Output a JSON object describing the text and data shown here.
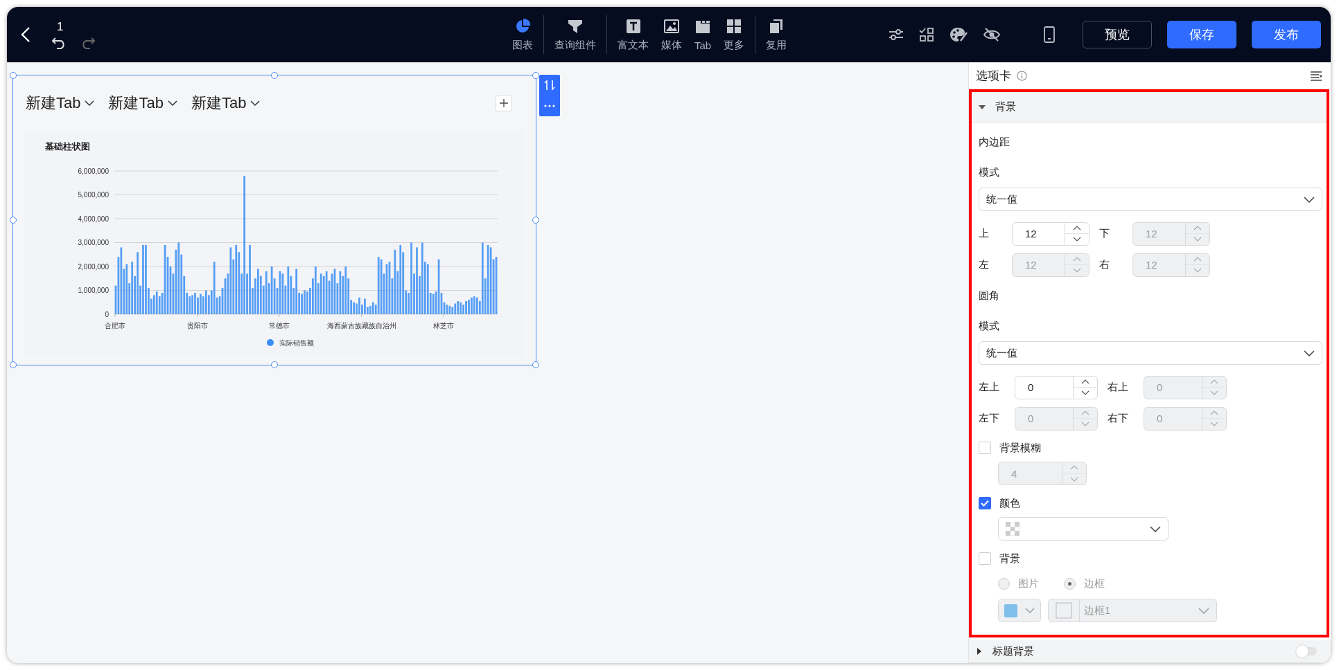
{
  "toolbar": {
    "page_number": "1",
    "undo_disabled": false,
    "redo_disabled": true,
    "tool_groups": [
      [
        {
          "label": "图表",
          "selected": true
        }
      ],
      [
        {
          "label": "查询组件",
          "selected": false
        }
      ],
      [
        {
          "label": "富文本",
          "selected": false
        },
        {
          "label": "媒体",
          "selected": false
        },
        {
          "label": "Tab",
          "selected": false
        },
        {
          "label": "更多",
          "selected": false
        }
      ],
      [
        {
          "label": "复用",
          "selected": false
        }
      ]
    ],
    "buttons": [
      {
        "label": "预览",
        "kind": "outline"
      },
      {
        "label": "保存",
        "kind": "primary"
      },
      {
        "label": "发布",
        "kind": "primary"
      }
    ]
  },
  "canvas": {
    "tabs": [
      {
        "label": "新建Tab"
      },
      {
        "label": "新建Tab"
      },
      {
        "label": "新建Tab"
      }
    ],
    "chart": {
      "x_labels": [
        "合肥市",
        "贵阳市",
        "常德市",
        "海西蒙古族藏族自治州",
        "林芝市"
      ],
      "chart_data": {
        "type": "bar",
        "title": "基础柱状图",
        "grid": true,
        "series": [
          {
            "name": "实际销售额",
            "color": "#3a8ef6",
            "values": [
              1200000,
              2400000,
              2800000,
              1900000,
              2100000,
              1300000,
              2200000,
              1600000,
              2600000,
              1200000,
              2900000,
              2900000,
              1100000,
              650000,
              800000,
              950000,
              750000,
              900000,
              2900000,
              2400000,
              2000000,
              1700000,
              2700000,
              3000000,
              2500000,
              1600000,
              900000,
              750000,
              800000,
              900000,
              700000,
              850000,
              750000,
              1000000,
              800000,
              1000000,
              2200000,
              700000,
              750000,
              1100000,
              1500000,
              1700000,
              2800000,
              2300000,
              2900000,
              2600000,
              1700000,
              5800000,
              1700000,
              2900000,
              1100000,
              1500000,
              1900000,
              1600000,
              1200000,
              1800000,
              1300000,
              2000000,
              1500000,
              1100000,
              1800000,
              1700000,
              1200000,
              2000000,
              1600000,
              1100000,
              1900000,
              900000,
              850000,
              1000000,
              950000,
              1100000,
              1500000,
              2000000,
              1300000,
              1700000,
              1600000,
              1800000,
              1400000,
              1700000,
              1900000,
              1300000,
              1800000,
              1600000,
              2000000,
              1500000,
              600000,
              500000,
              450000,
              700000,
              400000,
              650000,
              300000,
              350000,
              500000,
              400000,
              2400000,
              2300000,
              1700000,
              2100000,
              2200000,
              1500000,
              2700000,
              1800000,
              2900000,
              2600000,
              1000000,
              900000,
              3000000,
              1700000,
              2800000,
              1600000,
              3000000,
              2200000,
              2100000,
              900000,
              850000,
              950000,
              2300000,
              900000,
              500000,
              400000,
              350000,
              300000,
              450000,
              550000,
              500000,
              400000,
              550000,
              600000,
              700000,
              750000,
              700000,
              550000,
              3000000,
              1500000,
              2900000,
              2800000,
              2300000,
              2400000
            ]
          }
        ],
        "ylim": [
          0,
          6000000
        ],
        "yticks": [
          {
            "value": 0,
            "label": "0"
          },
          {
            "value": 1000000,
            "label": "1,000,000"
          },
          {
            "value": 2000000,
            "label": "2,000,000"
          },
          {
            "value": 3000000,
            "label": "3,000,000"
          },
          {
            "value": 4000000,
            "label": "4,000,000"
          },
          {
            "value": 5000000,
            "label": "5,000,000"
          },
          {
            "value": 6000000,
            "label": "6,000,000"
          }
        ]
      }
    }
  },
  "panel": {
    "title": "选项卡",
    "background_section": {
      "title": "背景",
      "expanded": true,
      "highlighted": true,
      "padding": {
        "label": "内边距",
        "mode_label": "模式",
        "mode": "统一值",
        "fields": [
          {
            "label": "上",
            "value": "12",
            "disabled": false
          },
          {
            "label": "下",
            "value": "12",
            "disabled": true
          },
          {
            "label": "左",
            "value": "12",
            "disabled": true
          },
          {
            "label": "右",
            "value": "12",
            "disabled": true
          }
        ]
      },
      "radius": {
        "label": "圆角",
        "mode_label": "模式",
        "mode": "统一值",
        "fields": [
          {
            "label": "左上",
            "value": "0",
            "disabled": false
          },
          {
            "label": "右上",
            "value": "0",
            "disabled": true
          },
          {
            "label": "左下",
            "value": "0",
            "disabled": true
          },
          {
            "label": "右下",
            "value": "0",
            "disabled": true
          }
        ]
      },
      "blur": {
        "label": "背景模糊",
        "checked": false,
        "value": "4"
      },
      "color": {
        "label": "颜色",
        "checked": true
      },
      "background": {
        "label": "背景",
        "checked": false,
        "options": [
          {
            "label": "图片",
            "selected": false
          },
          {
            "label": "边框",
            "selected": true
          }
        ],
        "border_style": "边框1"
      }
    },
    "title_section": {
      "title": "标题背景",
      "expanded": false,
      "on": false
    }
  }
}
